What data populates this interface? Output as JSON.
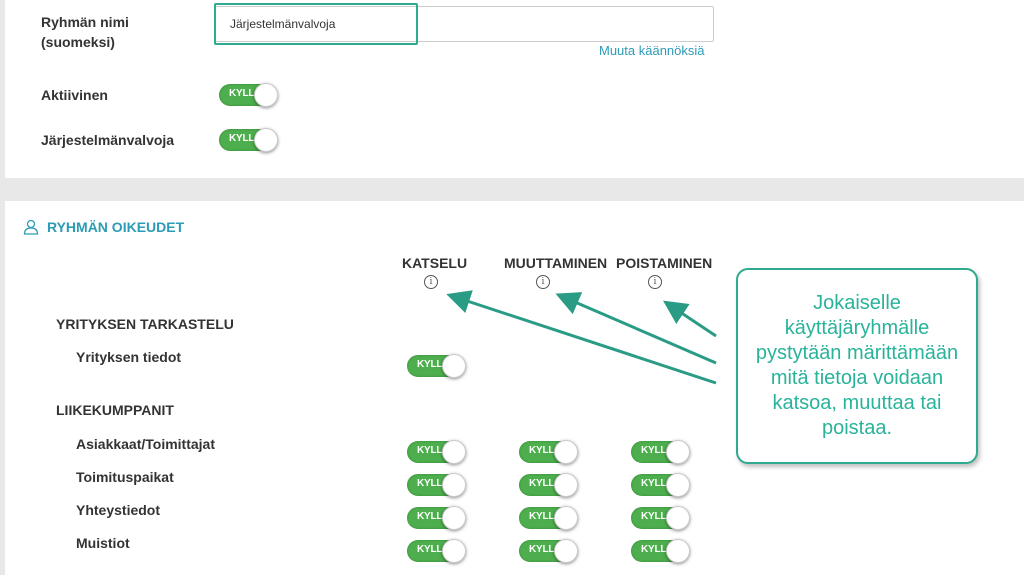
{
  "group_name": {
    "label": "Ryhmän nimi (suomeksi)",
    "value": "Järjestelmänvalvoja",
    "translations_link": "Muuta käännöksiä"
  },
  "toggles_top": [
    {
      "label": "Aktiivinen",
      "state": "KYLLÄ"
    },
    {
      "label": "Järjestelmänvalvoja",
      "state": "KYLLÄ"
    }
  ],
  "permissions": {
    "title": "RYHMÄN OIKEUDET",
    "columns": [
      "KATSELU",
      "MUUTTAMINEN",
      "POISTAMINEN"
    ],
    "toggle_text": "KYLLÄ",
    "sections": [
      {
        "title": "YRITYKSEN TARKASTELU",
        "rows": [
          {
            "label": "Yrityksen tiedot",
            "view": true,
            "edit": null,
            "delete": null
          }
        ]
      },
      {
        "title": "LIIKEKUMPPANIT",
        "rows": [
          {
            "label": "Asiakkaat/Toimittajat",
            "view": true,
            "edit": true,
            "delete": true
          },
          {
            "label": "Toimituspaikat",
            "view": true,
            "edit": true,
            "delete": true
          },
          {
            "label": "Yhteystiedot",
            "view": true,
            "edit": true,
            "delete": true
          },
          {
            "label": "Muistiot",
            "view": true,
            "edit": true,
            "delete": true
          }
        ]
      }
    ]
  },
  "callout": {
    "text": "Jokaiselle käyttäjäryhmälle pystytään märittämään mitä tietoja voidaan katsoa, muuttaa tai poistaa."
  },
  "colors": {
    "accent": "#2c9bb5",
    "toggle_on": "#4cae4c",
    "highlight": "#2eaa8e",
    "background": "#e8e8e8"
  }
}
